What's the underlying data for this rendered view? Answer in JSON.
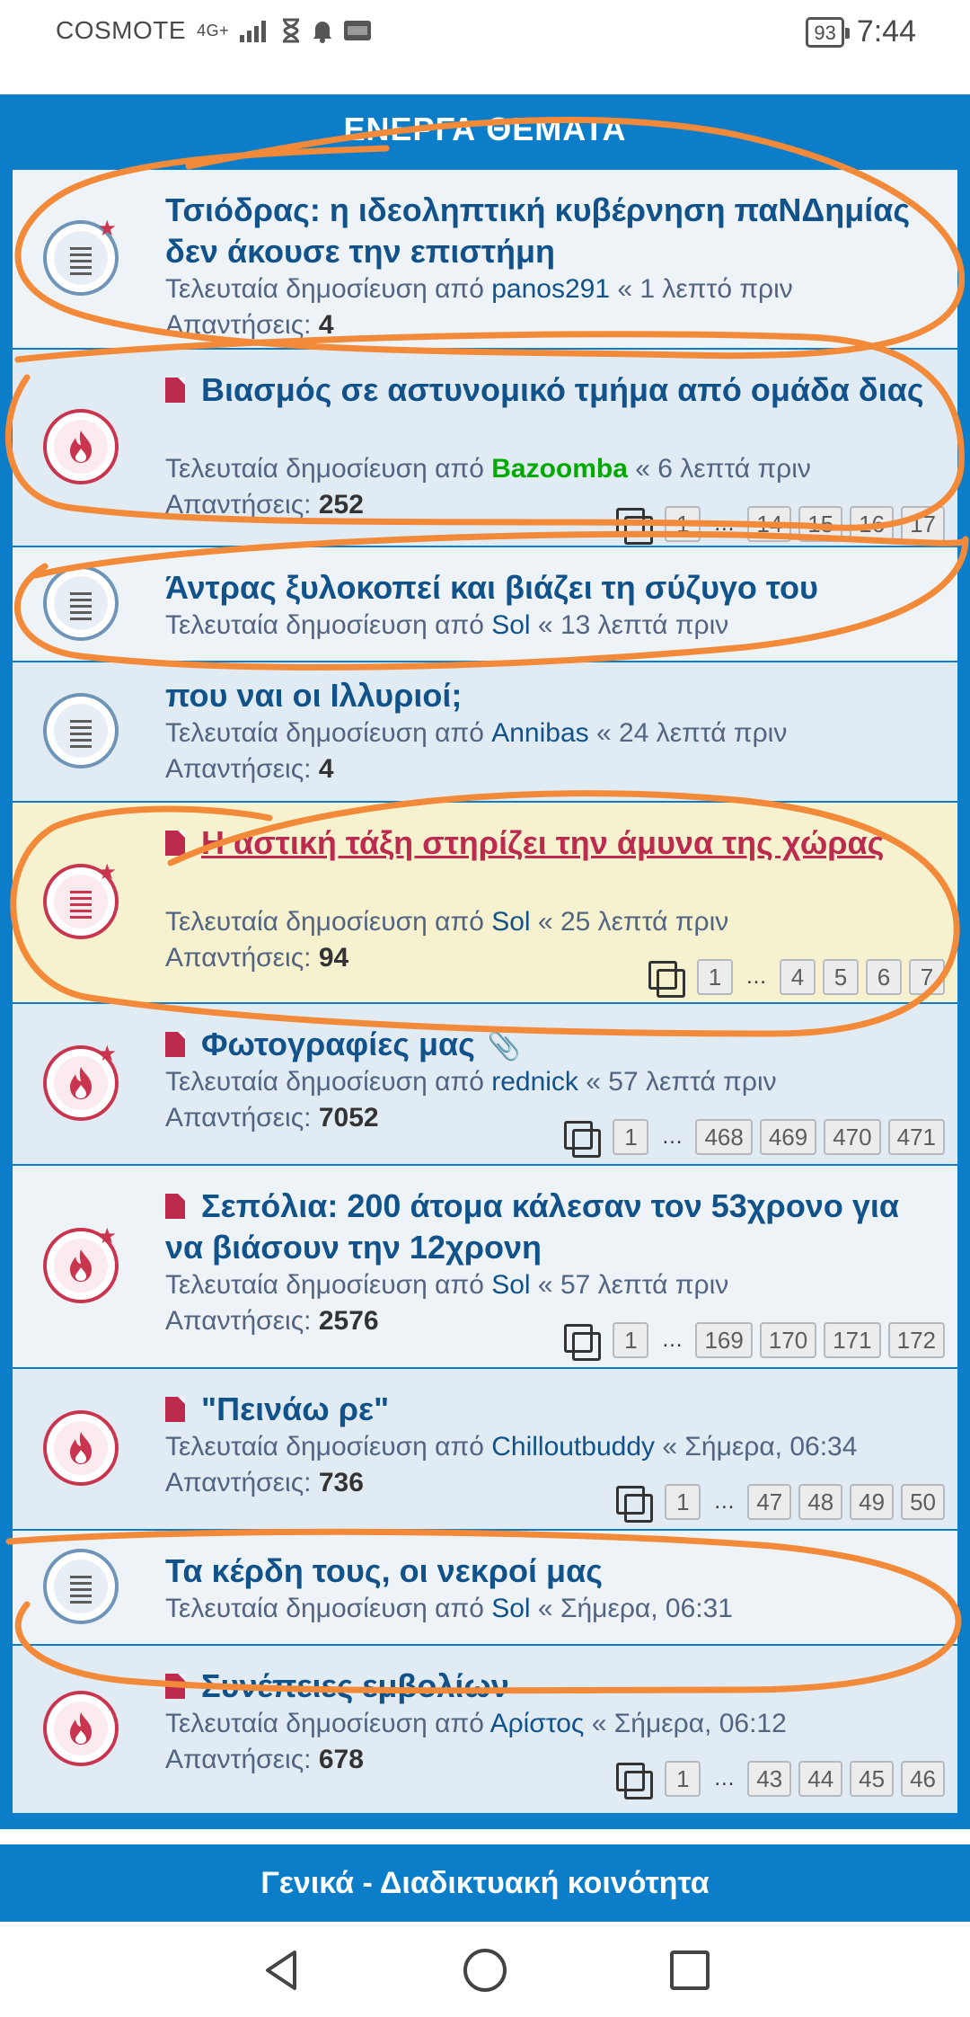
{
  "status_bar": {
    "carrier": "COSMOTE",
    "network": "4G+",
    "battery": "93",
    "time": "7:44",
    "icons": [
      "signal-icon",
      "hourglass-icon",
      "bell-icon",
      "imdb-icon"
    ]
  },
  "panel": {
    "header": "ΕΝΕΡΓΑ ΘΕΜΑΤΑ"
  },
  "labels": {
    "last_post_prefix": "Τελευταία δημοσίευση από",
    "replies_label": "Απαντήσεις:",
    "ellipsis": "…"
  },
  "topics": [
    {
      "title": "Τσιόδρας: η ιδεοληπτική κυβέρνηση παΝΔημίας δεν άκουσε την επιστήμη",
      "user": "panos291",
      "time": "« 1 λεπτό πριν",
      "replies": "4",
      "icon": "read",
      "starred": true,
      "has_file_icon": false,
      "pages": []
    },
    {
      "title": "Βιασμός σε αστυνομικό τμήμα από ομάδα διας",
      "user": "Bazoomba",
      "user_color": "#00aa00",
      "time": "« 6 λεπτά πριν",
      "replies": "252",
      "icon": "hot",
      "starred": false,
      "has_file_icon": true,
      "pages": [
        "1",
        "14",
        "15",
        "16",
        "17"
      ]
    },
    {
      "title": "Άντρας ξυλοκοπεί και βιάζει τη σύζυγο του",
      "user": "Sol",
      "time": "« 13 λεπτά πριν",
      "replies": "",
      "icon": "read",
      "starred": false,
      "has_file_icon": false,
      "pages": []
    },
    {
      "title": "που ναι οι Ιλλυριοί;",
      "user": "Annibas",
      "time": "« 24 λεπτά πριν",
      "replies": "4",
      "icon": "read",
      "starred": false,
      "has_file_icon": false,
      "pages": []
    },
    {
      "title": "Η αστική τάξη στηρίζει την άμυνα της χώρας",
      "user": "Sol",
      "time": "« 25 λεπτά πριν",
      "replies": "94",
      "icon": "hot-lines",
      "starred": true,
      "has_file_icon": true,
      "highlighted": true,
      "pages": [
        "1",
        "4",
        "5",
        "6",
        "7"
      ]
    },
    {
      "title": "Φωτογραφίες μας",
      "user": "rednick",
      "time": "« 57 λεπτά πριν",
      "replies": "7052",
      "icon": "hot",
      "starred": true,
      "has_file_icon": true,
      "attachment": true,
      "pages": [
        "1",
        "468",
        "469",
        "470",
        "471"
      ]
    },
    {
      "title": "Σεπόλια: 200 άτομα κάλεσαν τον 53χρονο για να βιάσουν την 12χρονη",
      "user": "Sol",
      "time": "« 57 λεπτά πριν",
      "replies": "2576",
      "icon": "hot",
      "starred": true,
      "has_file_icon": true,
      "pages": [
        "1",
        "169",
        "170",
        "171",
        "172"
      ]
    },
    {
      "title": "\"Πεινάω ρε\"",
      "user": "Chilloutbuddy",
      "time": "« Σήμερα, 06:34",
      "replies": "736",
      "icon": "hot",
      "starred": false,
      "has_file_icon": true,
      "pages": [
        "1",
        "47",
        "48",
        "49",
        "50"
      ]
    },
    {
      "title": "Τα κέρδη τους, οι νεκροί μας",
      "user": "Sol",
      "time": "« Σήμερα, 06:31",
      "replies": "",
      "icon": "read",
      "starred": false,
      "has_file_icon": false,
      "pages": []
    },
    {
      "title": "Συνέπειες εμβολίων",
      "user": "Αρίστος",
      "time": "« Σήμερα, 06:12",
      "replies": "678",
      "icon": "hot",
      "starred": false,
      "has_file_icon": true,
      "pages": [
        "1",
        "43",
        "44",
        "45",
        "46"
      ]
    }
  ],
  "forum_bar": "Γενικά - Διαδικτυακή κοινότητα",
  "colors": {
    "accent": "#0c7ec9",
    "title": "#105289",
    "hot": "#c9354e",
    "annotation": "#f28a3a"
  }
}
